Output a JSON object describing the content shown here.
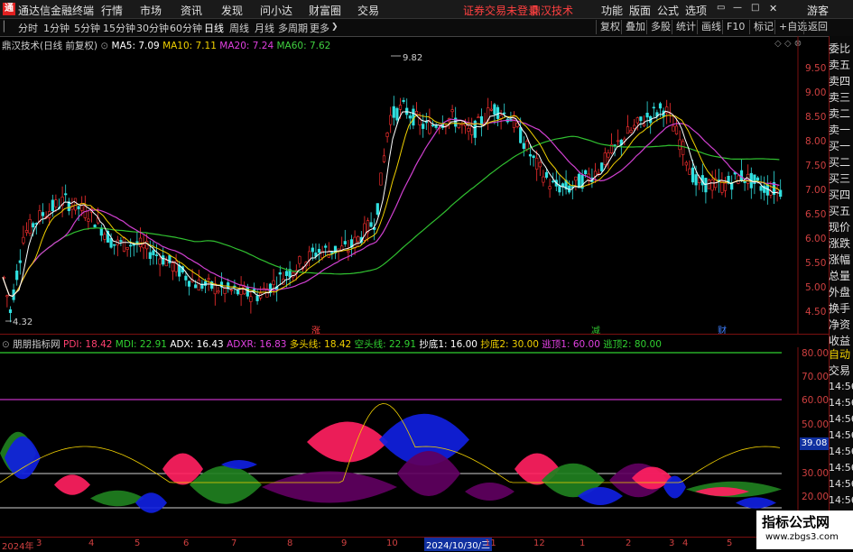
{
  "menubar": {
    "app_title": "通达信金融终端",
    "menus": [
      "行情",
      "市场",
      "资讯",
      "发现",
      "问小达",
      "财富圈",
      "交易"
    ],
    "notice": "证券交易未登录",
    "stock_name": "鼎汉技术",
    "right_menus": [
      "功能",
      "版面",
      "公式",
      "选项"
    ],
    "guest": "游客"
  },
  "periodbar": {
    "periods": [
      "分时",
      "1分钟",
      "5分钟",
      "15分钟",
      "30分钟",
      "60分钟",
      "日线",
      "周线",
      "月线",
      "多周期",
      "更多"
    ],
    "active": "日线",
    "tools": [
      "复权",
      "叠加",
      "多股",
      "统计",
      "画线",
      "F10",
      "标记",
      "+自选",
      "返回"
    ]
  },
  "main_legend": {
    "name": "鼎汉技术(日线 前复权)",
    "ma5": "MA5: 7.09",
    "ma10": "MA10: 7.11",
    "ma20": "MA20: 7.24",
    "ma60": "MA60: 7.62"
  },
  "main_chart": {
    "high_label": "9.82",
    "low_label": "4.32",
    "y_ticks": [
      "9.50",
      "9.00",
      "8.50",
      "8.00",
      "7.50",
      "7.00",
      "6.50",
      "6.00",
      "5.50",
      "5.00",
      "4.50"
    ],
    "markers": [
      "涨",
      "减",
      "财"
    ]
  },
  "indicator_legend": {
    "name": "朋朋指标网",
    "pdi": "PDI: 18.42",
    "mdi": "MDI: 22.91",
    "adx": "ADX: 16.43",
    "adxr": "ADXR: 16.83",
    "long": "多头线: 18.42",
    "short": "空头线: 22.91",
    "bottom1": "抄底1: 16.00",
    "bottom2": "抄底2: 30.00",
    "top1": "逃顶1: 60.00",
    "top2": "逃顶2: 80.00"
  },
  "indicator_chart": {
    "y_ticks": [
      "80.00",
      "70.00",
      "60.00",
      "50.00",
      "40.00",
      "30.00",
      "20.00"
    ],
    "current": "39.08"
  },
  "time_axis": {
    "labels": [
      "2024年",
      "3",
      "4",
      "5",
      "6",
      "7",
      "8",
      "9",
      "10",
      "2024/10/30/三",
      "11",
      "12",
      "1",
      "2",
      "3",
      "4",
      "5"
    ]
  },
  "side_panel": {
    "quote_items": [
      "委比",
      "卖五",
      "卖四",
      "卖三",
      "卖二",
      "卖一",
      "买一",
      "买二",
      "买三",
      "买四",
      "买五",
      "现价",
      "涨跌",
      "涨幅",
      "总量",
      "外盘",
      "换手",
      "净资",
      "收益"
    ],
    "auto": "自动",
    "trade": "交易",
    "times": [
      "14:56",
      "14:56",
      "14:56",
      "14:56",
      "14:56",
      "14:56",
      "14:56",
      "14:56"
    ]
  },
  "watermark": {
    "title": "指标公式网",
    "url": "www.zbgs3.com"
  }
}
